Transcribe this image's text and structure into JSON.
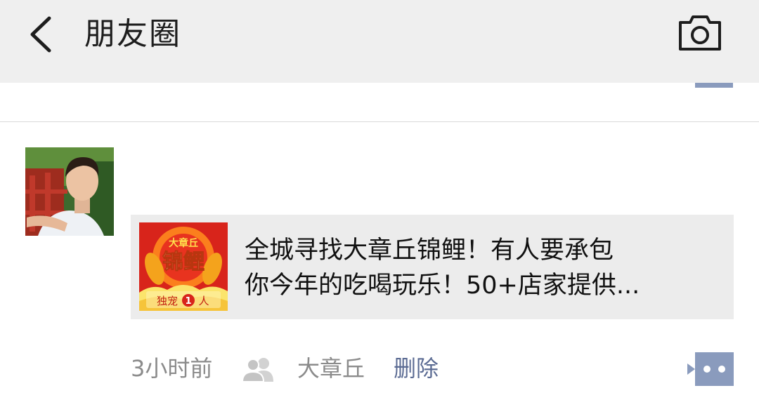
{
  "header": {
    "title": "朋友圈",
    "back_icon": "chevron-left-icon",
    "camera_icon": "camera-icon"
  },
  "post": {
    "link": {
      "thumb": {
        "brand": "大章丘",
        "headline": "锦鲤",
        "tagline": "独宠",
        "number": "1",
        "tag_suffix": "人"
      },
      "line1": "全城寻找大章丘锦鲤！有人要承包",
      "line2": "你今年的吃喝玩乐！50+店家提供..."
    },
    "meta": {
      "time": "3小时前",
      "location": "大章丘",
      "delete_label": "删除"
    }
  },
  "colors": {
    "header_bg": "#efefef",
    "link_color": "#5b6b93",
    "action_button": "#8a9bbd",
    "card_bg": "#ececec"
  }
}
